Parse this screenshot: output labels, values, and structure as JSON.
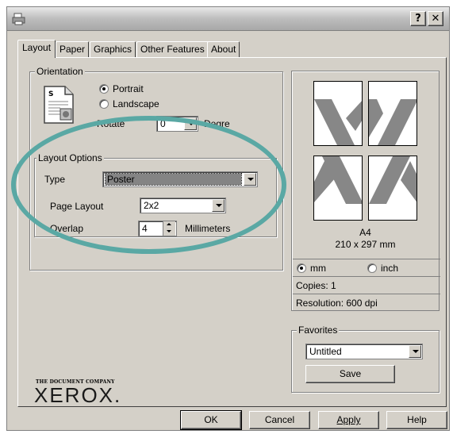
{
  "window": {
    "help_button": "?",
    "close_button": "✕"
  },
  "tabs": [
    {
      "label": "Layout",
      "active": true
    },
    {
      "label": "Paper",
      "active": false
    },
    {
      "label": "Graphics",
      "active": false
    },
    {
      "label": "Other Features",
      "active": false
    },
    {
      "label": "About",
      "active": false
    }
  ],
  "orientation": {
    "legend": "Orientation",
    "portrait_label": "Portrait",
    "landscape_label": "Landscape",
    "selected": "Portrait",
    "rotate_label": "Rotate",
    "rotate_value": "0",
    "degrees_label": "Degre"
  },
  "layout_options": {
    "legend": "Layout Options",
    "type_label": "Type",
    "type_value": "Poster",
    "page_layout_label": "Page Layout",
    "page_layout_value": "2x2",
    "overlap_label": "Overlap",
    "overlap_value": "4",
    "overlap_unit": "Millimeters"
  },
  "preview": {
    "paper_name": "A4",
    "paper_size": "210 x 297 mm",
    "unit_mm_label": "mm",
    "unit_inch_label": "inch",
    "selected_unit": "mm",
    "copies": "Copies: 1",
    "resolution": "Resolution: 600 dpi",
    "graphic_color": "#878787"
  },
  "favorites": {
    "legend": "Favorites",
    "value": "Untitled",
    "save_label": "Save"
  },
  "branding": {
    "tagline": "THE DOCUMENT COMPANY",
    "logo": "XEROX."
  },
  "footer": {
    "ok_label": "OK",
    "cancel_label": "Cancel",
    "apply_label": "Apply",
    "help_label": "Help"
  },
  "colors": {
    "dialog_bg": "#d4d0c8",
    "annotation_ring": "#5aa8a4"
  }
}
